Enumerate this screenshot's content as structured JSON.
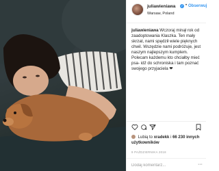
{
  "post": {
    "photo_icon": "woman-with-dog-photo",
    "header": {
      "username": "juliawieniawa",
      "verified_badge": "✓",
      "separator": "•",
      "follow_label": "Obserwuj",
      "location": "Warsaw, Poland"
    },
    "caption": {
      "username": "juliawieniawa",
      "text": "Wczoraj minął rok od zaadoptowania Klaszka. Ten mały skrzat, nami spędził wiele pięknych chwil. Wszędzie nami podróżuje, jest naszym najlepszym kumplem. Polecam każdemu kto chciałby mieć psa- idź do schroniska i tam poznać swojego przyjaciela ❤"
    },
    "actions": {
      "like_icon": "heart-icon",
      "comment_icon": "comment-icon",
      "share_icon": "share-icon",
      "save_icon": "bookmark-icon"
    },
    "likes": {
      "prefix": "Lubią to",
      "user": "xradekk",
      "conjunction": "i",
      "count": "66 230 innych użytkowników"
    },
    "date": "9 PAŹDZIERNIKA 2018",
    "comment": {
      "placeholder": "Dodaj komentarz...",
      "more_icon": "more-icon",
      "more_glyph": "···"
    }
  }
}
